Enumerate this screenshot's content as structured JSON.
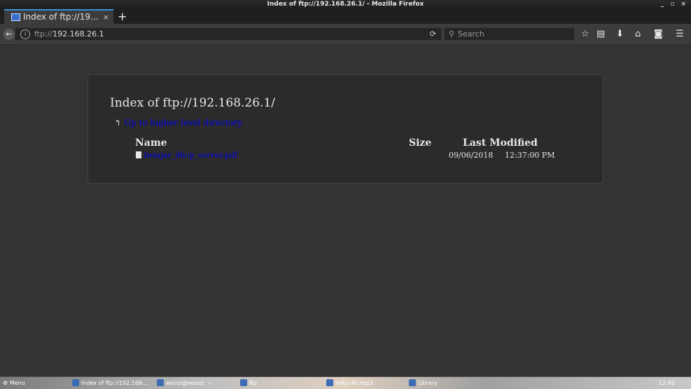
{
  "window": {
    "title": "Index of ftp://192.168.26.1/ - Mozilla Firefox",
    "controls": "_ ▫ ×"
  },
  "tab": {
    "label": "Index of ftp://19…",
    "close": "×",
    "new": "+"
  },
  "nav": {
    "url_scheme": "ftp://",
    "url_host": "192.168.26.1",
    "search_placeholder": "Search",
    "back": "←",
    "info": "i",
    "reload": "⟳"
  },
  "toolbar": {
    "star": "☆",
    "reader": "▤",
    "download": "⬇",
    "home": "⌂",
    "pocket": "◙",
    "menu": "☰"
  },
  "page": {
    "heading": "Index of ftp://192.168.26.1/",
    "up_link": "Up to higher level directory",
    "up_arrow": "↰",
    "columns": {
      "name": "Name",
      "size": "Size",
      "modified": "Last Modified"
    },
    "files": [
      {
        "name": "belajar_dhcp_server.pdf",
        "size": "",
        "date": "09/06/2018",
        "time": "12:37:00 PM"
      }
    ]
  },
  "taskbar": {
    "menu": "Menu",
    "tasks": [
      "Index of ftp://192.168....",
      "woozi@woozi: ~",
      "ftp",
      "miku 4U.mp3",
      "Library"
    ],
    "clock": "12:42"
  }
}
